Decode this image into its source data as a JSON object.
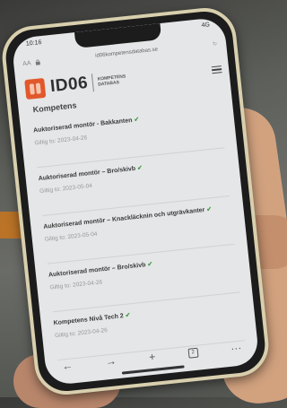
{
  "status_bar": {
    "time": "10:16",
    "signal": "4G"
  },
  "browser": {
    "text_size_label": "AA",
    "url": "id06kompetensdatabas.se"
  },
  "header": {
    "logo_text": "ID06",
    "logo_subtitle_line1": "KOMPETENS",
    "logo_subtitle_line2": "DATABAS"
  },
  "section": {
    "title": "Kompetens"
  },
  "competencies": [
    {
      "title": "Auktoriserad montör - Bakkanten",
      "validity": "Giltig to: 2023-04-26"
    },
    {
      "title": "Auktoriserad montör – Bro/skivb",
      "validity": "Giltig to: 2023-05-04"
    },
    {
      "title": "Auktoriserad montör – Knackläcknin och utgrävkanter",
      "validity": "Giltig to: 2023-05-04"
    },
    {
      "title": "Auktoriserad montör – Bro/skivb",
      "validity": "Giltig to: 2023-04-26"
    },
    {
      "title": "Kompetens Nivå Tech 2",
      "validity": "Giltig to: 2023-04-26"
    }
  ],
  "toolbar": {
    "back": "←",
    "forward": "→",
    "new_tab": "+",
    "tabs_count": "2",
    "more": "···"
  }
}
